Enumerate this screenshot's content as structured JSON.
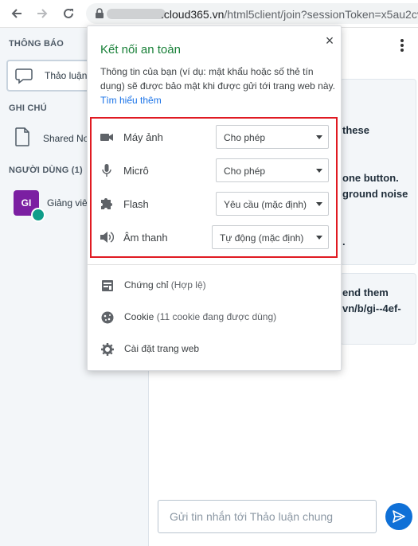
{
  "browser": {
    "url_host": ".cloud365.vn",
    "url_path": "/html5client/join?sessionToken=x5au2cv"
  },
  "sidebar": {
    "notifications_title": "THÔNG BÁO",
    "chat_label": "Thảo luận",
    "notes_title": "GHI CHÚ",
    "notes_label": "Shared Not",
    "users_title": "NGƯỜI DÙNG (1)",
    "user_initials": "GI",
    "user_name": "Giảng viê"
  },
  "main": {
    "card1_lines": [
      "these",
      "one button.",
      "ground noise"
    ],
    "card2_lines": [
      "end them",
      "vn/b/gi--4ef-"
    ],
    "composer_placeholder": "Gửi tin nhắn tới Thảo luận chung"
  },
  "popup": {
    "title": "Kết nối an toàn",
    "description": "Thông tin của bạn (ví dụ: mật khẩu hoặc số thẻ tín dụng) sẽ được bảo mật khi được gửi tới trang web này.",
    "learn_more": "Tìm hiểu thêm",
    "close_symbol": "×",
    "permissions": [
      {
        "label": "Máy ảnh",
        "value": "Cho phép",
        "icon": "camera-icon"
      },
      {
        "label": "Micrô",
        "value": "Cho phép",
        "icon": "microphone-icon"
      },
      {
        "label": "Flash",
        "value": "Yêu cầu (mặc định)",
        "icon": "puzzle-icon"
      },
      {
        "label": "Âm thanh",
        "value": "Tự động (mặc định)",
        "icon": "sound-icon"
      }
    ],
    "certificate_label": "Chứng chỉ",
    "certificate_status": "(Hợp lệ)",
    "cookie_label": "Cookie",
    "cookie_status": "(11 cookie đang được dùng)",
    "site_settings_label": "Cài đặt trang web"
  },
  "colors": {
    "highlight_border": "#e01a22",
    "secure_title": "#188038",
    "link": "#1a73e8",
    "send_button": "#0f70d7",
    "avatar": "#7b1fa2"
  }
}
